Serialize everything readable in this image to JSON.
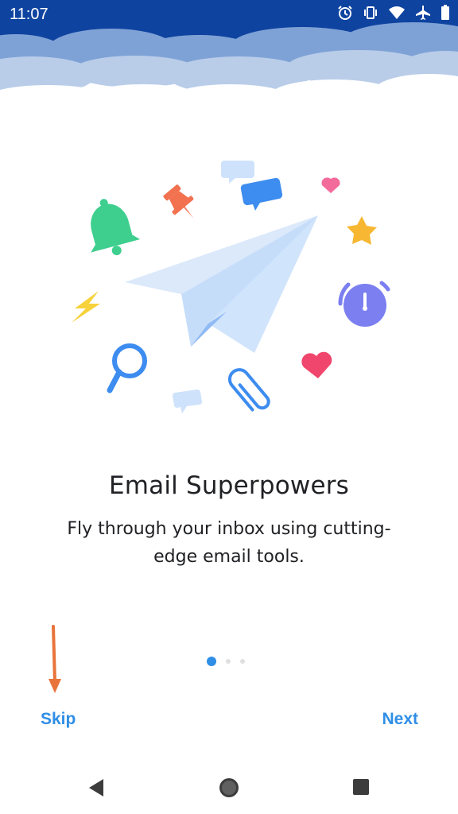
{
  "status_bar": {
    "time": "11:07",
    "icons": [
      "alarm-icon",
      "vibrate-icon",
      "wifi-icon",
      "airplane-icon",
      "battery-icon"
    ]
  },
  "onboarding": {
    "title": "Email Superpowers",
    "subtitle": "Fly through your inbox using cutting-edge email tools.",
    "page_indicator": {
      "current": 1,
      "total": 3
    },
    "skip_label": "Skip",
    "next_label": "Next",
    "accent_color": "#2f8ee6",
    "annotation_arrow_color": "#e8743b"
  },
  "illustration_items": [
    "paper-plane-icon",
    "bell-icon",
    "pin-icon",
    "chat-bubble-icon",
    "heart-icon",
    "star-icon",
    "lightning-icon",
    "alarm-clock-icon",
    "magnifier-icon",
    "paperclip-icon"
  ],
  "nav_bar": {
    "buttons": [
      "back-button",
      "home-button",
      "recents-button"
    ]
  }
}
